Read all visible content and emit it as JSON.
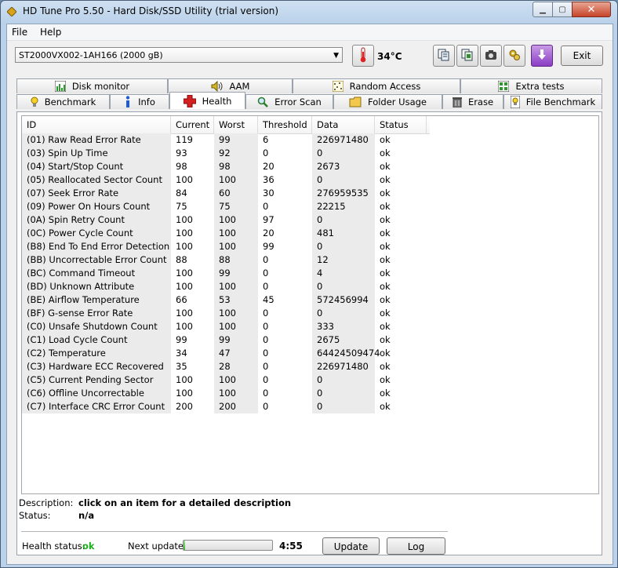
{
  "window": {
    "title": "HD Tune Pro 5.50 - Hard Disk/SSD Utility (trial version)"
  },
  "menu": {
    "file": "File",
    "help": "Help"
  },
  "toolbar": {
    "drive": "ST2000VX002-1AH166 (2000 gB)",
    "temperature": "34°C",
    "exit_label": "Exit",
    "icons": [
      "thermometer-icon",
      "copy-text-icon",
      "copy-screen-icon",
      "camera-icon",
      "options-icon",
      "save-icon"
    ]
  },
  "tabs_top": [
    "Disk monitor",
    "AAM",
    "Random Access",
    "Extra tests"
  ],
  "tabs_bottom": [
    "Benchmark",
    "Info",
    "Health",
    "Error Scan",
    "Folder Usage",
    "Erase",
    "File Benchmark"
  ],
  "active_tab": "Health",
  "table": {
    "headers": [
      "ID",
      "Current",
      "Worst",
      "Threshold",
      "Data",
      "Status"
    ],
    "rows": [
      [
        "(01) Raw Read Error Rate",
        "119",
        "99",
        "6",
        "226971480",
        "ok"
      ],
      [
        "(03) Spin Up Time",
        "93",
        "92",
        "0",
        "0",
        "ok"
      ],
      [
        "(04) Start/Stop Count",
        "98",
        "98",
        "20",
        "2673",
        "ok"
      ],
      [
        "(05) Reallocated Sector Count",
        "100",
        "100",
        "36",
        "0",
        "ok"
      ],
      [
        "(07) Seek Error Rate",
        "84",
        "60",
        "30",
        "276959535",
        "ok"
      ],
      [
        "(09) Power On Hours Count",
        "75",
        "75",
        "0",
        "22215",
        "ok"
      ],
      [
        "(0A) Spin Retry Count",
        "100",
        "100",
        "97",
        "0",
        "ok"
      ],
      [
        "(0C) Power Cycle Count",
        "100",
        "100",
        "20",
        "481",
        "ok"
      ],
      [
        "(B8) End To End Error Detection",
        "100",
        "100",
        "99",
        "0",
        "ok"
      ],
      [
        "(BB) Uncorrectable Error Count",
        "88",
        "88",
        "0",
        "12",
        "ok"
      ],
      [
        "(BC) Command Timeout",
        "100",
        "99",
        "0",
        "4",
        "ok"
      ],
      [
        "(BD) Unknown Attribute",
        "100",
        "100",
        "0",
        "0",
        "ok"
      ],
      [
        "(BE) Airflow Temperature",
        "66",
        "53",
        "45",
        "572456994",
        "ok"
      ],
      [
        "(BF) G-sense Error Rate",
        "100",
        "100",
        "0",
        "0",
        "ok"
      ],
      [
        "(C0) Unsafe Shutdown Count",
        "100",
        "100",
        "0",
        "333",
        "ok"
      ],
      [
        "(C1) Load Cycle Count",
        "99",
        "99",
        "0",
        "2675",
        "ok"
      ],
      [
        "(C2) Temperature",
        "34",
        "47",
        "0",
        "64424509474",
        "ok"
      ],
      [
        "(C3) Hardware ECC Recovered",
        "35",
        "28",
        "0",
        "226971480",
        "ok"
      ],
      [
        "(C5) Current Pending Sector",
        "100",
        "100",
        "0",
        "0",
        "ok"
      ],
      [
        "(C6) Offline Uncorrectable",
        "100",
        "100",
        "0",
        "0",
        "ok"
      ],
      [
        "(C7) Interface CRC Error Count",
        "200",
        "200",
        "0",
        "0",
        "ok"
      ]
    ]
  },
  "details": {
    "description_label": "Description:",
    "description_value": "click on an item for a detailed description",
    "status_label": "Status:",
    "status_value": "n/a"
  },
  "footer": {
    "health_label": "Health status:",
    "health_value": "ok",
    "next_update_label": "Next update:",
    "progress_fraction": 0.02,
    "countdown": "4:55",
    "update_label": "Update",
    "log_label": "Log"
  },
  "colors": {
    "ok_green": "#1bb01b",
    "progress": "#3cb32b"
  }
}
